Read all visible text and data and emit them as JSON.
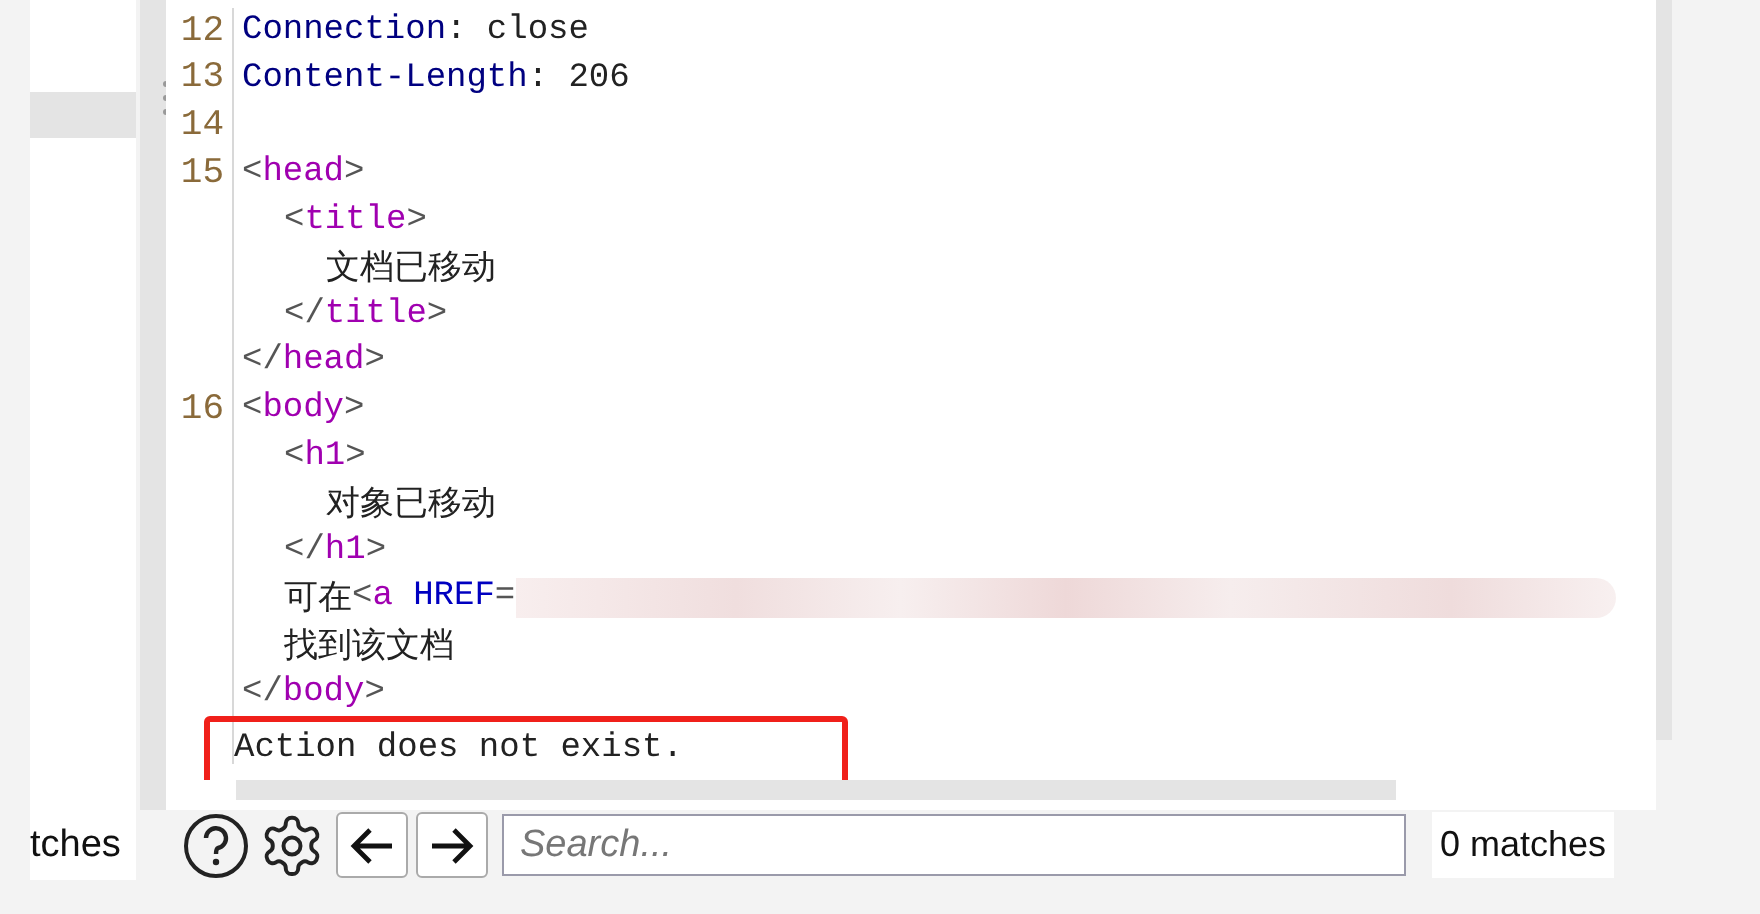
{
  "lines": [
    {
      "number": "12",
      "segments": [
        {
          "kind": "header",
          "text": "Connection"
        },
        {
          "kind": "plain",
          "text": ": close"
        }
      ]
    },
    {
      "number": "13",
      "segments": [
        {
          "kind": "header",
          "text": "Content-Length"
        },
        {
          "kind": "plain",
          "text": ": 206"
        }
      ]
    },
    {
      "number": "14"
    },
    {
      "number": "15",
      "segments": [
        {
          "kind": "punct",
          "text": "<"
        },
        {
          "kind": "tag",
          "text": "head"
        },
        {
          "kind": "punct",
          "text": ">"
        }
      ],
      "children": [
        {
          "segments": [
            {
              "kind": "punct",
              "text": "<"
            },
            {
              "kind": "tag",
              "text": "title"
            },
            {
              "kind": "punct",
              "text": ">"
            }
          ],
          "children": [
            {
              "segments": [
                {
                  "kind": "plain",
                  "text": "文档已移动"
                }
              ]
            }
          ]
        },
        {
          "segments": [
            {
              "kind": "punct",
              "text": "</"
            },
            {
              "kind": "tag",
              "text": "title"
            },
            {
              "kind": "punct",
              "text": ">"
            }
          ]
        }
      ]
    },
    {
      "segments": [
        {
          "kind": "punct",
          "text": "</"
        },
        {
          "kind": "tag",
          "text": "head"
        },
        {
          "kind": "punct",
          "text": ">"
        }
      ]
    },
    {
      "number": "16",
      "segments": [
        {
          "kind": "punct",
          "text": "<"
        },
        {
          "kind": "tag",
          "text": "body"
        },
        {
          "kind": "punct",
          "text": ">"
        }
      ],
      "children": [
        {
          "segments": [
            {
              "kind": "punct",
              "text": "<"
            },
            {
              "kind": "tag",
              "text": "h1"
            },
            {
              "kind": "punct",
              "text": ">"
            }
          ],
          "children": [
            {
              "segments": [
                {
                  "kind": "plain",
                  "text": "对象已移动"
                }
              ]
            }
          ]
        },
        {
          "segments": [
            {
              "kind": "punct",
              "text": "</"
            },
            {
              "kind": "tag",
              "text": "h1"
            },
            {
              "kind": "punct",
              "text": ">"
            }
          ]
        },
        {
          "segments": [
            {
              "kind": "plain",
              "text": "可在"
            },
            {
              "kind": "punct",
              "text": "<"
            },
            {
              "kind": "tag",
              "text": "a"
            },
            {
              "kind": "attr",
              "text": " HREF"
            },
            {
              "kind": "punct",
              "text": "="
            },
            {
              "kind": "redacted"
            }
          ]
        },
        {
          "segments": [
            {
              "kind": "plain",
              "text": "找到该文档"
            }
          ]
        }
      ]
    },
    {
      "segments": [
        {
          "kind": "punct",
          "text": "</"
        },
        {
          "kind": "tag",
          "text": "body"
        },
        {
          "kind": "punct",
          "text": ">"
        }
      ]
    },
    {
      "annotated": true,
      "segments": [
        {
          "kind": "plain",
          "text": "Action does not exist."
        }
      ]
    }
  ],
  "left_panel": {
    "label": "tches"
  },
  "search": {
    "placeholder": "Search...",
    "matches": "0 matches"
  }
}
